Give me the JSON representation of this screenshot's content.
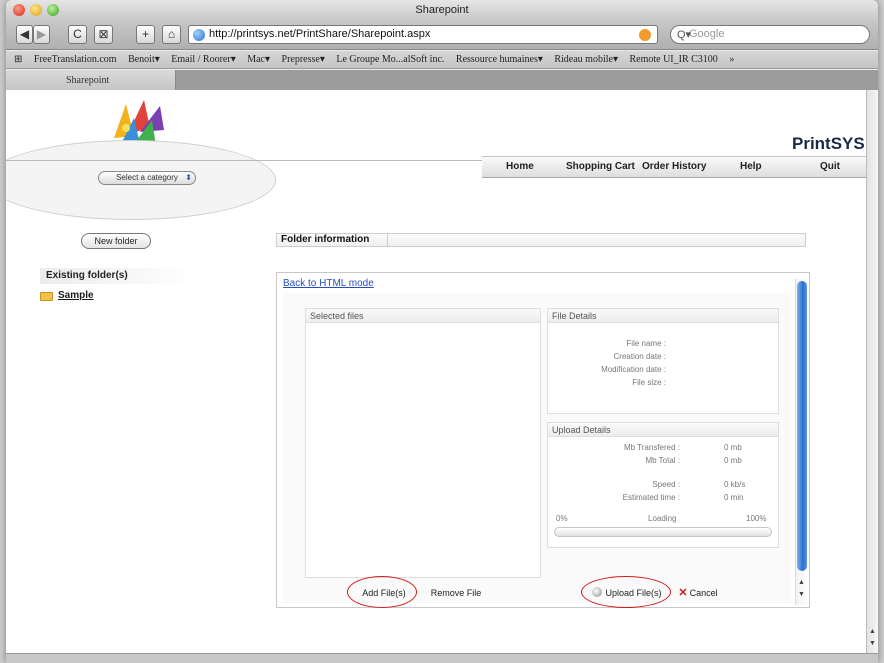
{
  "window": {
    "title": "Sharepoint"
  },
  "toolbar": {
    "back_glyph": "◀",
    "forward_glyph": "▶",
    "reload_glyph": "C",
    "screenshot_glyph": "⊠",
    "add_glyph": "+",
    "home_glyph": "⌂",
    "url": "http://printsys.net/PrintShare/Sharepoint.aspx",
    "search_placeholder": "Google",
    "search_glyph": "Q▾"
  },
  "bookmarks": {
    "book_glyph": "⊞",
    "items": [
      "FreeTranslation.com",
      "Benoit▾",
      "Email / Roorer▾",
      "Mac▾",
      "Prepresse▾",
      "Le Groupe Mo...alSoft inc.",
      "Ressource humaines▾",
      "Rideau mobile▾",
      "Remote UI_IR C3100"
    ],
    "overflow": "»"
  },
  "tab": {
    "label": "Sharepoint"
  },
  "site": {
    "brand": "PrintSYS",
    "nav": {
      "home": "Home",
      "cart": "Shopping Cart",
      "history": "Order History",
      "help": "Help",
      "quit": "Quit"
    },
    "category_select": "Select a category",
    "category_arrows": "⬍"
  },
  "sidebar": {
    "new_folder": "New folder",
    "existing_head": "Existing folder(s)",
    "folders": [
      "Sample"
    ]
  },
  "main": {
    "folder_info_label": "Folder information",
    "html_mode_link": "Back to HTML mode",
    "selected_files_head": "Selected files",
    "file_details": {
      "head": "File Details",
      "file_name": "File name :",
      "creation_date": "Creation date :",
      "modification_date": "Modification date :",
      "file_size": "File size :"
    },
    "upload_details": {
      "head": "Upload Details",
      "mb_transferred_label": "Mb Transfered :",
      "mb_transferred_value": "0 mb",
      "mb_total_label": "Mb Total :",
      "mb_total_value": "0 mb",
      "speed_label": "Speed :",
      "speed_value": "0 kb/s",
      "estimated_label": "Estimated time :",
      "estimated_value": "0 min",
      "progress_start": "0%",
      "progress_status": "Loading",
      "progress_end": "100%",
      "progress_fraction": 0
    },
    "buttons": {
      "add_files": "Add File(s)",
      "remove_file": "Remove File",
      "upload_files": "Upload File(s)",
      "cancel": "Cancel"
    }
  },
  "scroll": {
    "up": "▲",
    "down": "▼"
  }
}
